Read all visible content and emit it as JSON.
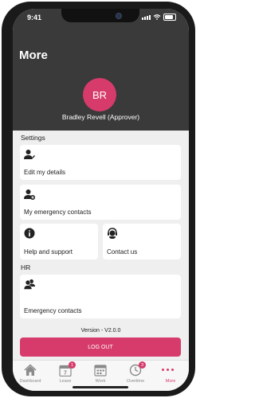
{
  "status_bar": {
    "time": "9:41"
  },
  "page": {
    "title": "More"
  },
  "profile": {
    "initials": "BR",
    "name": "Bradley Revell (Approver)",
    "avatar_color": "#d63b6b"
  },
  "sections": {
    "settings_label": "Settings",
    "hr_label": "HR"
  },
  "cards": {
    "edit_details": {
      "label": "Edit my details",
      "icon": "user-edit-icon"
    },
    "emergency_contacts_mine": {
      "label": "My emergency contacts",
      "icon": "user-add-icon"
    },
    "help_support": {
      "label": "Help and support",
      "icon": "info-icon"
    },
    "contact_us": {
      "label": "Contact us",
      "icon": "headset-icon"
    },
    "emergency_contacts": {
      "label": "Emergency contacts",
      "icon": "users-icon"
    }
  },
  "version": "Version - V2.0.0",
  "logout_label": "LOG OUT",
  "tabbar": {
    "dashboard": {
      "label": "Dashboard",
      "icon": "home-icon"
    },
    "leave": {
      "label": "Leave",
      "icon": "calendar-icon",
      "badge": "1"
    },
    "work": {
      "label": "Work",
      "icon": "briefcase-icon"
    },
    "overtime": {
      "label": "Overtime",
      "icon": "clock-icon",
      "badge": "3"
    },
    "more": {
      "label": "More",
      "icon": "more-dots-icon"
    }
  },
  "colors": {
    "accent": "#d63b6b",
    "header_bg": "#3a3a3a",
    "screen_bg": "#efefef"
  }
}
